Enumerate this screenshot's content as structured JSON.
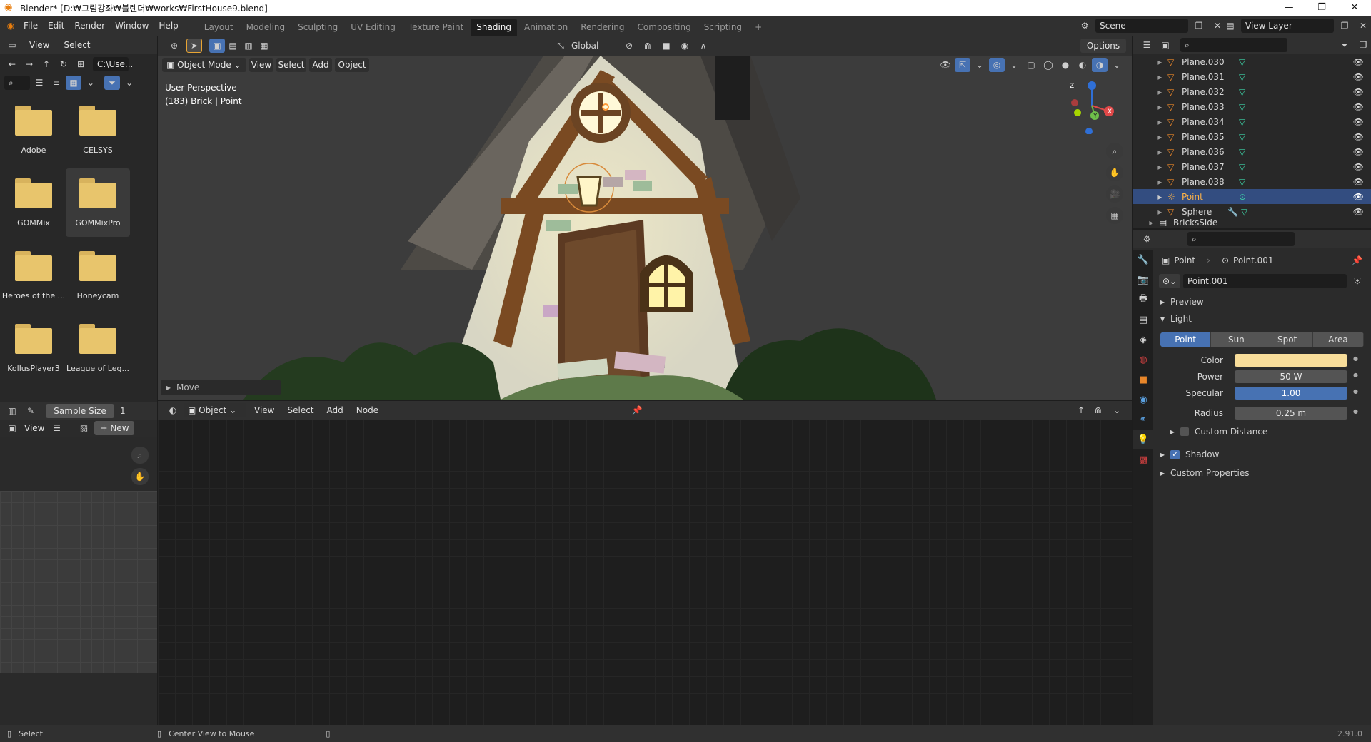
{
  "window": {
    "title": "Blender* [D:₩그림강좌₩블렌더₩works₩FirstHouse9.blend]",
    "controls": [
      "—",
      "❐",
      "✕"
    ]
  },
  "menubar": {
    "items": [
      "File",
      "Edit",
      "Render",
      "Window",
      "Help"
    ],
    "workspaces": [
      "Layout",
      "Modeling",
      "Sculpting",
      "UV Editing",
      "Texture Paint",
      "Shading",
      "Animation",
      "Rendering",
      "Compositing",
      "Scripting"
    ],
    "active_workspace": "Shading",
    "add_tab": "+",
    "scene": "Scene",
    "view_layer": "View Layer"
  },
  "file_browser": {
    "menu": [
      "View",
      "Select"
    ],
    "path": "C:\\Use...",
    "folders": [
      "Adobe",
      "CELSYS",
      "GOMMix",
      "GOMMixPro",
      "Heroes of the ...",
      "Honeycam",
      "KollusPlayer3",
      "League of Leg..."
    ],
    "selected_folder": "GOMMixPro"
  },
  "image_editor": {
    "sample_size_label": "Sample Size",
    "sample_size_value": "1",
    "view_label": "View",
    "new_label": "New"
  },
  "viewport": {
    "header": {
      "mode": "Object Mode",
      "menu": [
        "View",
        "Select",
        "Add",
        "Object"
      ],
      "transform": "Global",
      "options": "Options"
    },
    "overlay": {
      "perspective": "User Perspective",
      "object_info": "(183) Brick | Point"
    },
    "last_operator": "Move",
    "gizmo_axes": [
      "Z",
      "X",
      "Y"
    ]
  },
  "node_editor": {
    "header": {
      "type": "Object",
      "menu": [
        "View",
        "Select",
        "Add",
        "Node"
      ]
    }
  },
  "outliner": {
    "rows": [
      {
        "name": "Plane.030",
        "type": "mesh"
      },
      {
        "name": "Plane.031",
        "type": "mesh"
      },
      {
        "name": "Plane.032",
        "type": "mesh"
      },
      {
        "name": "Plane.033",
        "type": "mesh"
      },
      {
        "name": "Plane.034",
        "type": "mesh"
      },
      {
        "name": "Plane.035",
        "type": "mesh"
      },
      {
        "name": "Plane.036",
        "type": "mesh"
      },
      {
        "name": "Plane.037",
        "type": "mesh"
      },
      {
        "name": "Plane.038",
        "type": "mesh"
      },
      {
        "name": "Point",
        "type": "light",
        "selected": true
      },
      {
        "name": "Sphere",
        "type": "mesh"
      },
      {
        "name": "BricksSide",
        "type": "collection"
      }
    ]
  },
  "properties": {
    "breadcrumb_object": "Point",
    "breadcrumb_data": "Point.001",
    "datablock_name": "Point.001",
    "sections": {
      "preview": "Preview",
      "light": "Light",
      "custom_distance": "Custom Distance",
      "shadow": "Shadow",
      "custom_properties": "Custom Properties"
    },
    "light_types": [
      "Point",
      "Sun",
      "Spot",
      "Area"
    ],
    "active_light_type": "Point",
    "fields": {
      "color_label": "Color",
      "color_value": "#f8dd9a",
      "power_label": "Power",
      "power_value": "50 W",
      "specular_label": "Specular",
      "specular_value": "1.00",
      "specular_fraction": 1.0,
      "radius_label": "Radius",
      "radius_value": "0.25 m"
    },
    "shadow_checked": true,
    "custom_distance_checked": false
  },
  "statusbar": {
    "left_action": "Select",
    "middle_action": "Center View to Mouse",
    "version": "2.91.0"
  },
  "colors": {
    "accent": "#4772b3",
    "selection_text": "#ffb347",
    "mesh_icon": "#e8862a",
    "vertex_icon": "#3dd5a8",
    "light_color": "#f8dd9a"
  }
}
